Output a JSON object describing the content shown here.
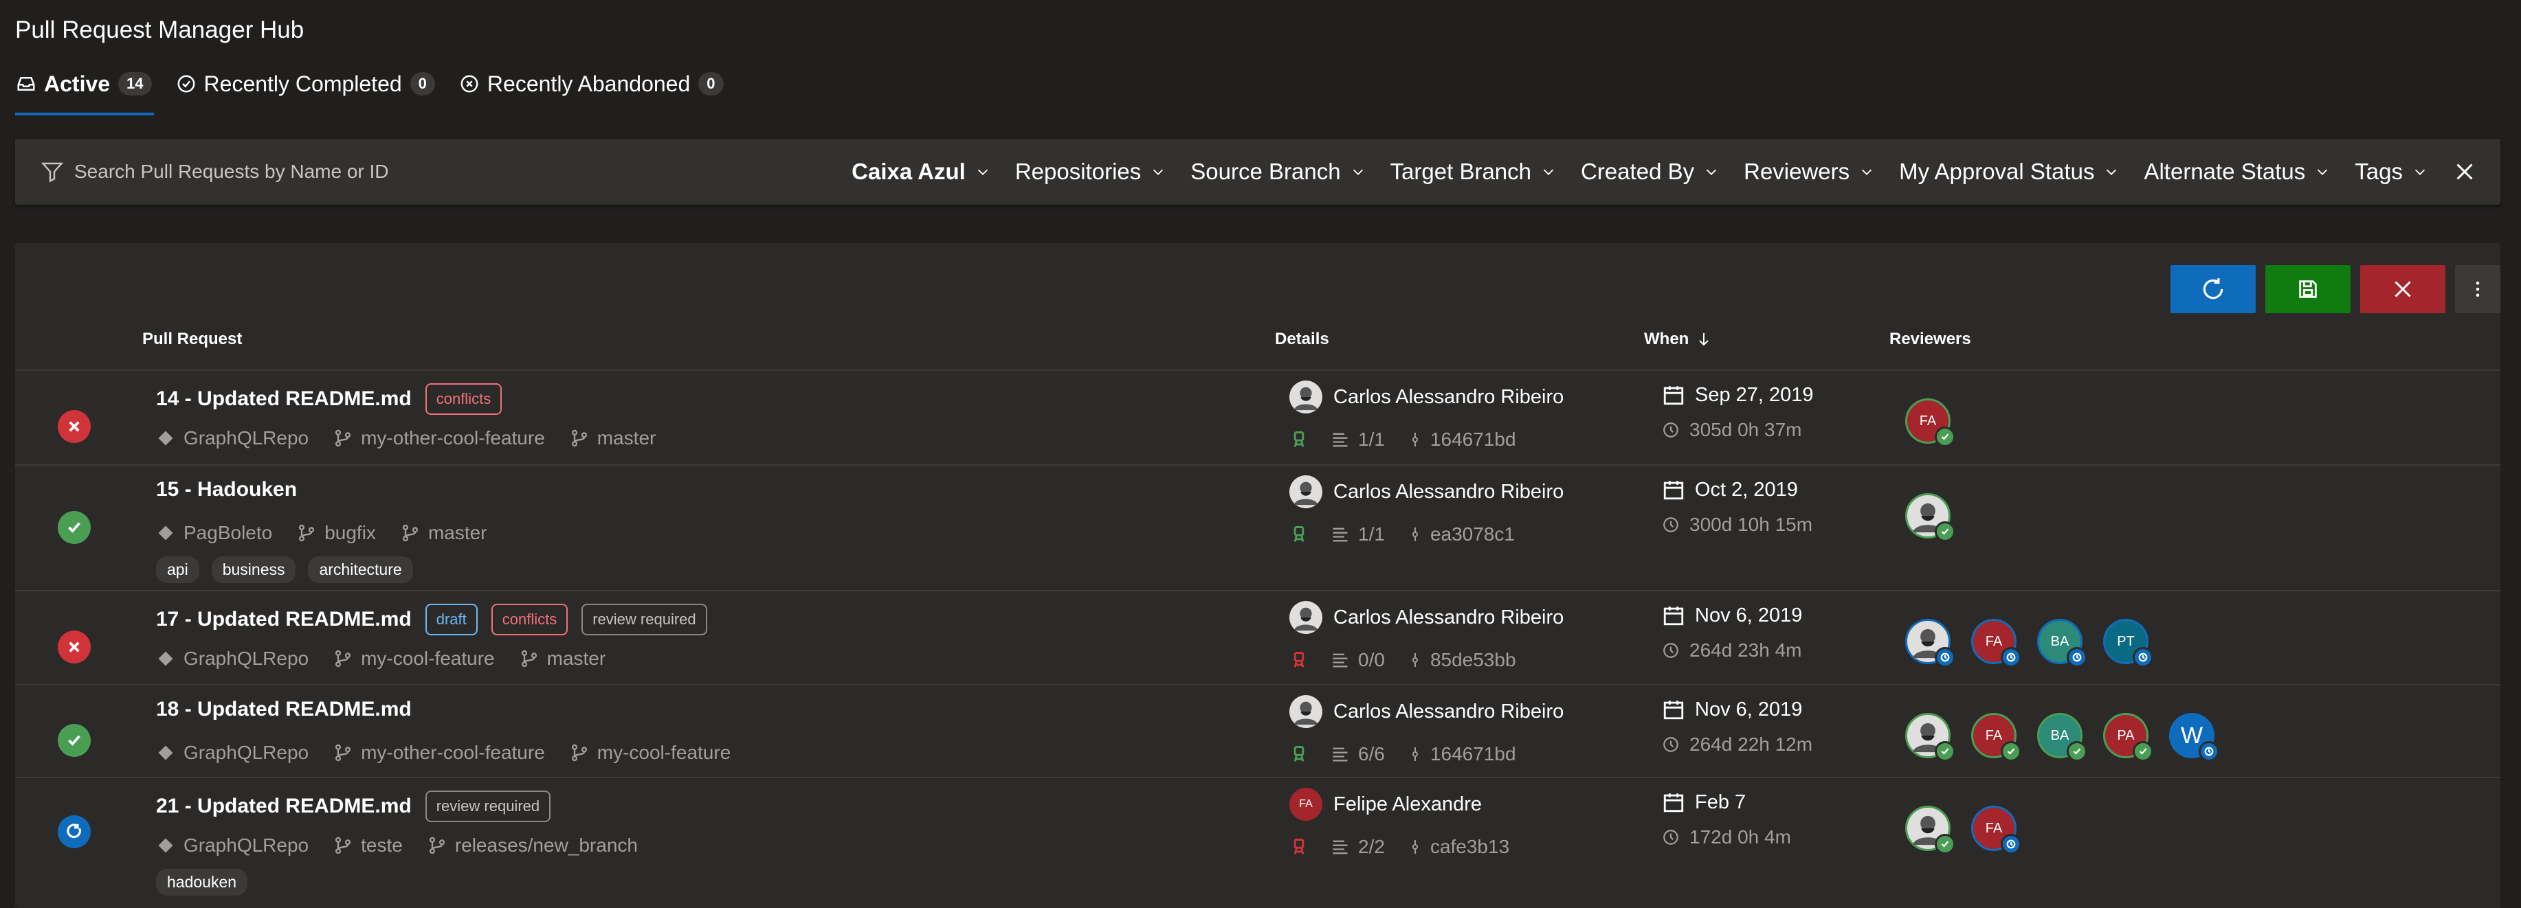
{
  "app": {
    "title": "Pull Request Manager Hub"
  },
  "tabs": [
    {
      "label": "Active",
      "count": "14",
      "icon": "inbox-icon"
    },
    {
      "label": "Recently Completed",
      "count": "0",
      "icon": "check-circle-icon"
    },
    {
      "label": "Recently Abandoned",
      "count": "0",
      "icon": "x-circle-icon"
    }
  ],
  "filter": {
    "placeholder": "Search Pull Requests by Name or ID",
    "dropdowns": [
      "Caixa Azul",
      "Repositories",
      "Source Branch",
      "Target Branch",
      "Created By",
      "Reviewers",
      "My Approval Status",
      "Alternate Status",
      "Tags"
    ]
  },
  "columns": {
    "pull_request": "Pull Request",
    "details": "Details",
    "when": "When",
    "reviewers": "Reviewers"
  },
  "colors": {
    "accent": "#0f6cbd",
    "approved": "#4a9e54",
    "rejected": "#d13438",
    "bg": "#201f1e",
    "card": "#2b2a29"
  },
  "rows": [
    {
      "status": "rejected",
      "title": "14 - Updated README.md",
      "tags": [
        {
          "text": "conflicts",
          "kind": "conflicts"
        }
      ],
      "repo": "GraphQLRepo",
      "source": "my-other-cool-feature",
      "target": "master",
      "labels": [],
      "author": "Carlos Alessandro Ribeiro",
      "author_initials": "",
      "build": "green",
      "policies": "1/1",
      "commit": "164671bd",
      "date": "Sep 27, 2019",
      "ago": "305d 0h 37m",
      "reviewers": [
        {
          "initials": "FA",
          "color": "#a4262c",
          "vote": "approved"
        }
      ]
    },
    {
      "status": "approved",
      "title": "15 - Hadouken",
      "tags": [],
      "repo": "PagBoleto",
      "source": "bugfix",
      "target": "master",
      "labels": [
        "api",
        "business",
        "architecture"
      ],
      "author": "Carlos Alessandro Ribeiro",
      "author_initials": "",
      "build": "green",
      "policies": "1/1",
      "commit": "ea3078c1",
      "date": "Oct 2, 2019",
      "ago": "300d 10h 15m",
      "reviewers": [
        {
          "initials": "",
          "color": "#4a9e54",
          "vote": "approved"
        }
      ]
    },
    {
      "status": "rejected",
      "title": "17 - Updated README.md",
      "tags": [
        {
          "text": "draft",
          "kind": "draft"
        },
        {
          "text": "conflicts",
          "kind": "conflicts"
        },
        {
          "text": "review required",
          "kind": "review"
        }
      ],
      "repo": "GraphQLRepo",
      "source": "my-cool-feature",
      "target": "master",
      "labels": [],
      "author": "Carlos Alessandro Ribeiro",
      "author_initials": "",
      "build": "red",
      "policies": "0/0",
      "commit": "85de53bb",
      "date": "Nov 6, 2019",
      "ago": "264d 23h 4m",
      "reviewers": [
        {
          "initials": "",
          "color": "#0f6cbd",
          "vote": "waiting"
        },
        {
          "initials": "FA",
          "color": "#a4262c",
          "vote": "waiting"
        },
        {
          "initials": "BA",
          "color": "#2b8a78",
          "vote": "waiting"
        },
        {
          "initials": "PT",
          "color": "#0b6a83",
          "vote": "waiting"
        }
      ]
    },
    {
      "status": "approved",
      "title": "18 - Updated README.md",
      "tags": [],
      "repo": "GraphQLRepo",
      "source": "my-other-cool-feature",
      "target": "my-cool-feature",
      "labels": [],
      "author": "Carlos Alessandro Ribeiro",
      "author_initials": "",
      "build": "green",
      "policies": "6/6",
      "commit": "164671bd",
      "date": "Nov 6, 2019",
      "ago": "264d 22h 12m",
      "reviewers": [
        {
          "initials": "",
          "color": "#4a9e54",
          "vote": "approved"
        },
        {
          "initials": "FA",
          "color": "#a4262c",
          "vote": "approved"
        },
        {
          "initials": "BA",
          "color": "#2b8a78",
          "vote": "approved"
        },
        {
          "initials": "PA",
          "color": "#a4262c",
          "vote": "approved"
        },
        {
          "initials": "W",
          "color": "#0f6cbd",
          "vote": "waiting"
        }
      ]
    },
    {
      "status": "waiting",
      "title": "21 - Updated README.md",
      "tags": [
        {
          "text": "review required",
          "kind": "review"
        }
      ],
      "repo": "GraphQLRepo",
      "source": "teste",
      "target": "releases/new_branch",
      "labels": [
        "hadouken"
      ],
      "author": "Felipe Alexandre",
      "author_initials": "FA",
      "build": "red",
      "policies": "2/2",
      "commit": "cafe3b13",
      "date": "Feb 7",
      "ago": "172d 0h 4m",
      "reviewers": [
        {
          "initials": "",
          "color": "#4a9e54",
          "vote": "approved"
        },
        {
          "initials": "FA",
          "color": "#a4262c",
          "vote": "waiting"
        }
      ]
    }
  ]
}
